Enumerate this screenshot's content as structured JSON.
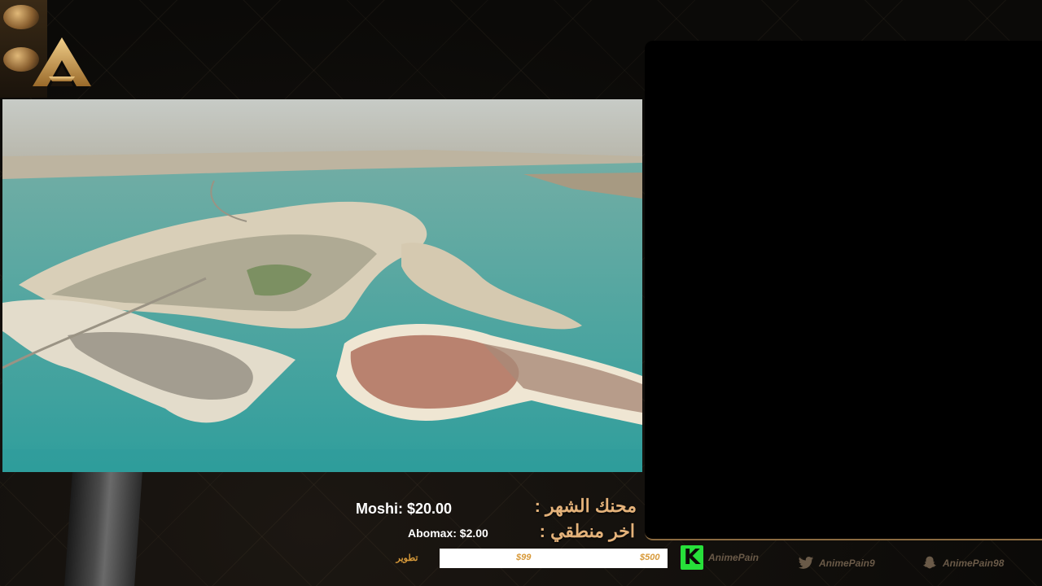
{
  "video": {
    "description_icon": "aerial-islands-video"
  },
  "top_donor": {
    "label": "محنك الشهر :",
    "value": "Moshi: $20.00"
  },
  "latest_donor": {
    "label": "اخر منطقي :",
    "value": "Abomax: $2.00"
  },
  "goal": {
    "label": "تطوير",
    "mark_mid": "$99",
    "mark_end": "$500"
  },
  "socials": [
    {
      "icon": "kick-icon",
      "handle": "AnimePain"
    },
    {
      "icon": "twitter-icon",
      "handle": "AnimePain9"
    },
    {
      "icon": "snapchat-icon",
      "handle": "AnimePain98"
    }
  ],
  "colors": {
    "accent_gold": "#e4b27a",
    "goal_text": "#d89a3a",
    "kick_green": "#27e03a"
  }
}
